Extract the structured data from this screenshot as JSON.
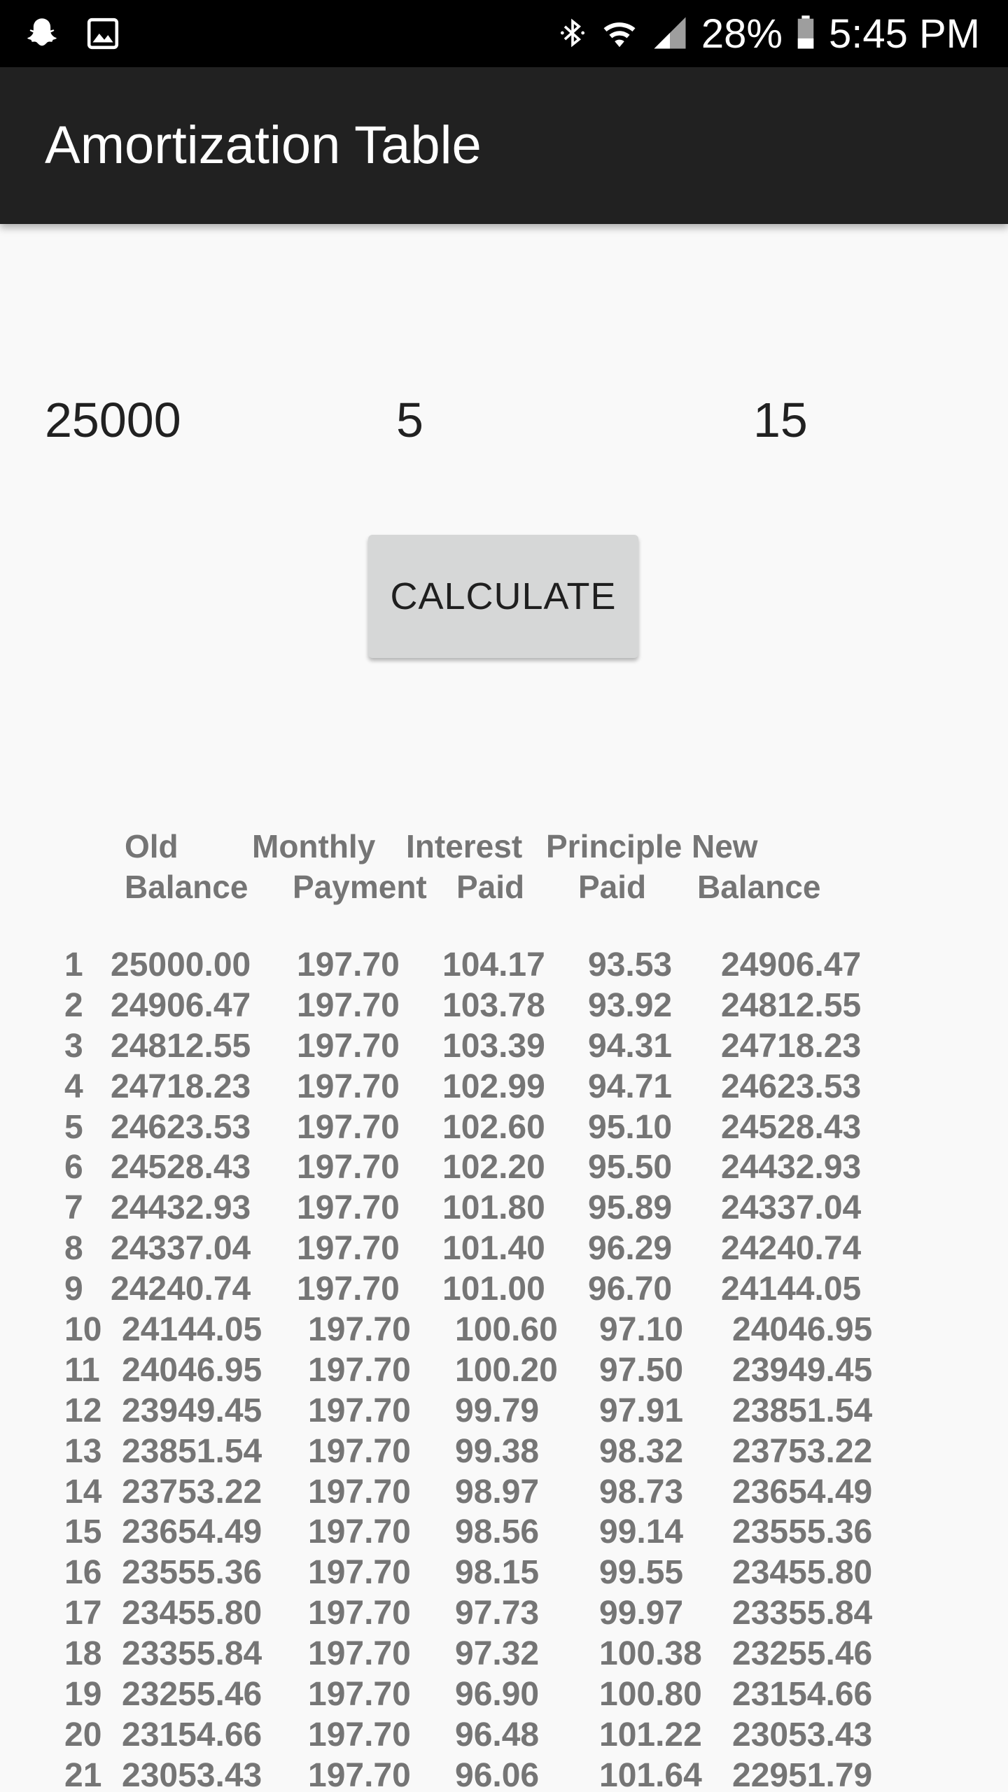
{
  "status_bar": {
    "icons": [
      "snapchat-icon",
      "image-icon",
      "bluetooth-icon",
      "wifi-icon",
      "signal-icon",
      "battery-icon"
    ],
    "battery": "28%",
    "time": "5:45 PM"
  },
  "app_bar": {
    "title": "Amortization Table"
  },
  "inputs": {
    "principal": "25000",
    "rate": "5",
    "years": "15"
  },
  "calculate_button": {
    "label": "CALCULATE"
  },
  "table": {
    "headers": [
      {
        "line1": "Old",
        "line2": "Balance"
      },
      {
        "line1": "Monthly",
        "line2": "Payment"
      },
      {
        "line1": "Interest",
        "line2": "Paid"
      },
      {
        "line1": "Principle",
        "line2": "Paid"
      },
      {
        "line1": "New",
        "line2": "Balance"
      }
    ],
    "rows": [
      [
        "1",
        "25000.00",
        "197.70",
        "104.17",
        "93.53",
        "24906.47"
      ],
      [
        "2",
        "24906.47",
        "197.70",
        "103.78",
        "93.92",
        "24812.55"
      ],
      [
        "3",
        "24812.55",
        "197.70",
        "103.39",
        "94.31",
        "24718.23"
      ],
      [
        "4",
        "24718.23",
        "197.70",
        "102.99",
        "94.71",
        "24623.53"
      ],
      [
        "5",
        "24623.53",
        "197.70",
        "102.60",
        "95.10",
        "24528.43"
      ],
      [
        "6",
        "24528.43",
        "197.70",
        "102.20",
        "95.50",
        "24432.93"
      ],
      [
        "7",
        "24432.93",
        "197.70",
        "101.80",
        "95.89",
        "24337.04"
      ],
      [
        "8",
        "24337.04",
        "197.70",
        "101.40",
        "96.29",
        "24240.74"
      ],
      [
        "9",
        "24240.74",
        "197.70",
        "101.00",
        "96.70",
        "24144.05"
      ],
      [
        "10",
        "24144.05",
        "197.70",
        "100.60",
        "97.10",
        "24046.95"
      ],
      [
        "11",
        "24046.95",
        "197.70",
        "100.20",
        "97.50",
        "23949.45"
      ],
      [
        "12",
        "23949.45",
        "197.70",
        "99.79",
        "97.91",
        "23851.54"
      ],
      [
        "13",
        "23851.54",
        "197.70",
        "99.38",
        "98.32",
        "23753.22"
      ],
      [
        "14",
        "23753.22",
        "197.70",
        "98.97",
        "98.73",
        "23654.49"
      ],
      [
        "15",
        "23654.49",
        "197.70",
        "98.56",
        "99.14",
        "23555.36"
      ],
      [
        "16",
        "23555.36",
        "197.70",
        "98.15",
        "99.55",
        "23455.80"
      ],
      [
        "17",
        "23455.80",
        "197.70",
        "97.73",
        "99.97",
        "23355.84"
      ],
      [
        "18",
        "23355.84",
        "197.70",
        "97.32",
        "100.38",
        "23255.46"
      ],
      [
        "19",
        "23255.46",
        "197.70",
        "96.90",
        "100.80",
        "23154.66"
      ],
      [
        "20",
        "23154.66",
        "197.70",
        "96.48",
        "101.22",
        "23053.43"
      ],
      [
        "21",
        "23053.43",
        "197.70",
        "96.06",
        "101.64",
        "22951.79"
      ]
    ]
  }
}
